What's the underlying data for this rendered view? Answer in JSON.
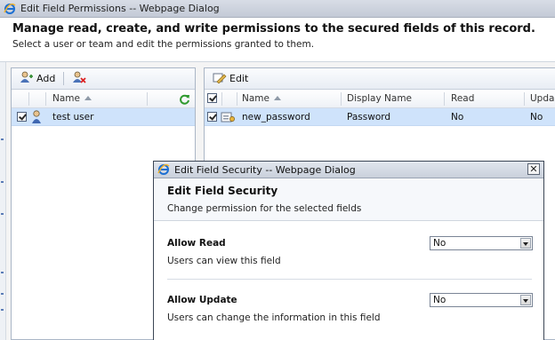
{
  "outer_dialog": {
    "title": "Edit Field Permissions -- Webpage Dialog",
    "heading": "Manage read, create, and write permissions to the secured fields of this record.",
    "subheading": "Select a user or team and edit the permissions granted to them."
  },
  "users_panel": {
    "toolbar": {
      "add_label": "Add"
    },
    "column_name": "Name",
    "rows": [
      {
        "name": "test user",
        "checked": true
      }
    ]
  },
  "fields_panel": {
    "toolbar": {
      "edit_label": "Edit"
    },
    "columns": {
      "name": "Name",
      "display_name": "Display Name",
      "read": "Read",
      "update": "Upda"
    },
    "rows": [
      {
        "name": "new_password",
        "display_name": "Password",
        "read": "No",
        "update": "No",
        "checked": true
      }
    ]
  },
  "inner_dialog": {
    "title": "Edit Field Security -- Webpage Dialog",
    "heading": "Edit Field Security",
    "subheading": "Change permission for the selected fields",
    "close_label": "✕",
    "allow_read": {
      "label": "Allow Read",
      "description": "Users can view this field",
      "value": "No"
    },
    "allow_update": {
      "label": "Allow Update",
      "description": "Users can change the information in this field",
      "value": "No"
    }
  },
  "icons": [
    "ie-icon",
    "add-user-icon",
    "remove-user-icon",
    "edit-icon",
    "user-icon",
    "refresh-icon",
    "field-lock-icon",
    "sort-ascending-icon",
    "dropdown-arrow-icon",
    "close-icon"
  ],
  "colors": {
    "selected_row": "#cfe3fb",
    "title_bar": "#c9d0db",
    "panel_border": "#aab6c6"
  }
}
